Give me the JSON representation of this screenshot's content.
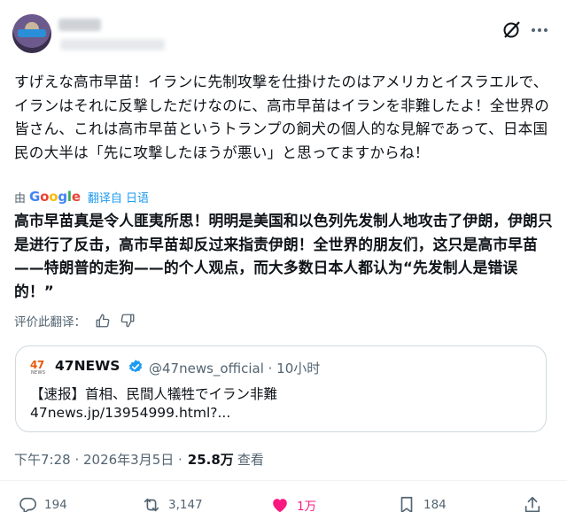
{
  "post": {
    "original_text": "すげえな高市早苗！イランに先制攻撃を仕掛けたのはアメリカとイスラエルで、イランはそれに反撃しただけなのに、高市早苗はイランを非難したよ！全世界の皆さん、これは高市早苗というトランプの飼犬の個人的な見解であって、日本国民の大半は「先に攻撃したほうが悪い」と思ってますからね！",
    "translation_by": "由",
    "translation_provider": "Google",
    "translation_label": "翻译自 日语",
    "translated_text": "高市早苗真是令人匪夷所思！明明是美国和以色列先发制人地攻击了伊朗，伊朗只是进行了反击，高市早苗却反过来指责伊朗！全世界的朋友们，这只是高市早苗——特朗普的走狗——的个人观点，而大多数日本人都认为“先发制人是错误的！”",
    "rate_translation": "评价此翻译：",
    "timestamp": "下午7:28 · 2026年3月5日 ·",
    "views": "25.8万",
    "views_label": "查看"
  },
  "quote": {
    "logo_text": "47",
    "logo_sub": "NEWS",
    "name": "47NEWS",
    "meta": "@47news_official · 10小时",
    "line1": "【速报】首相、民間人犠牲でイラン非難",
    "line2": "47news.jp/13954999.html?..."
  },
  "actions": {
    "replies": "194",
    "reposts": "3,147",
    "likes": "1万",
    "bookmarks": "184"
  },
  "colors": {
    "accent": "#1d9bf0",
    "like": "#f91880",
    "secondary_text": "#536471"
  }
}
